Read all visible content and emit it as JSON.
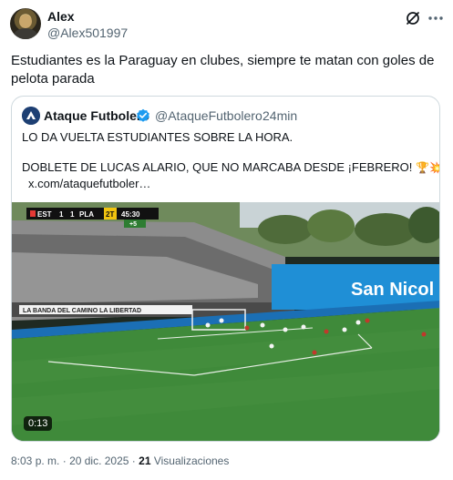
{
  "tweet": {
    "author_name": "Alex",
    "author_handle": "@Alex501997",
    "text": "Estudiantes es la Paraguay en clubes, siempre te matan con goles de pelota parada"
  },
  "quote": {
    "author_name": "Ataque Futbolero",
    "author_handle": "@AtaqueFutbolero",
    "separator": "·",
    "time": "24min",
    "line1": "LO DA VUELTA ESTUDIANTES SOBRE LA HORA.",
    "line2": "DOBLETE DE LUCAS ALARIO, QUE NO MARCABA DESDE ¡FEBRERO!",
    "emojis": "🏆💥",
    "link": "x.com/ataquefutboler…",
    "video": {
      "duration": "0:13",
      "scoreboard": {
        "home": "EST",
        "home_score": "1",
        "away_score": "1",
        "away": "PLA",
        "period": "2T",
        "clock": "45:30",
        "added": "+5"
      },
      "stand_banner": "LA BANDA DEL CAMINO LA LIBERTAD",
      "ad_board": "San Nicol"
    }
  },
  "meta": {
    "time": "8:03 p. m.",
    "separator1": "·",
    "date": "20 dic. 2025",
    "separator2": "·",
    "views_count": "21",
    "views_label": "Visualizaciones"
  },
  "colors": {
    "text_primary": "#0f1419",
    "text_secondary": "#536471",
    "border": "#cfd9de",
    "verified": "#1d9bf0",
    "pitch": "#3f8a3a"
  },
  "icons": [
    "grok-icon",
    "more-icon",
    "verified-badge-icon"
  ]
}
